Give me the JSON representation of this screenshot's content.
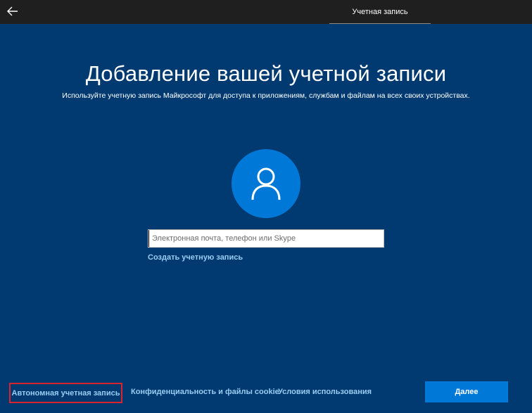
{
  "header": {
    "back_icon": "arrow-left-icon",
    "tab_label": "Учетная запись"
  },
  "main": {
    "title": "Добавление вашей учетной записи",
    "subtitle": "Используйте учетную запись Майкрософт для доступа к приложениям, службам и файлам на всех своих устройствах.",
    "avatar_icon": "person-icon",
    "input_placeholder": "Электронная почта, телефон или Skype",
    "input_value": "",
    "create_account_label": "Создать учетную запись"
  },
  "footer": {
    "offline_account_label": "Автономная учетная запись",
    "privacy_label": "Конфиденциальность и файлы cookie",
    "terms_label": "Условия использования",
    "next_label": "Далее"
  },
  "colors": {
    "background": "#003a70",
    "topbar": "#1f1f1f",
    "accent": "#0078d7",
    "link": "#99cdf3",
    "highlight_border": "#d9232e"
  }
}
